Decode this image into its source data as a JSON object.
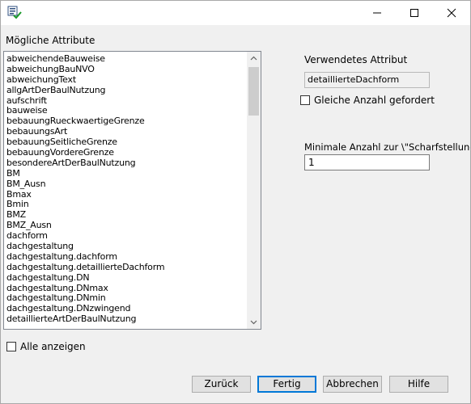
{
  "window": {
    "minimize_glyph": "—",
    "maximize_glyph": "☐",
    "close_glyph": "✕"
  },
  "available": {
    "label": "Mögliche Attribute",
    "items": [
      "abweichendeBauweise",
      "abweichungBauNVO",
      "abweichungText",
      "allgArtDerBaulNutzung",
      "aufschrift",
      "bauweise",
      "bebauungRueckwaertigeGrenze",
      "bebauungsArt",
      "bebauungSeitlicheGrenze",
      "bebauungVordereGrenze",
      "besondereArtDerBaulNutzung",
      "BM",
      "BM_Ausn",
      "Bmax",
      "Bmin",
      "BMZ",
      "BMZ_Ausn",
      "dachform",
      "dachgestaltung",
      "dachgestaltung.dachform",
      "dachgestaltung.detaillierteDachform",
      "dachgestaltung.DN",
      "dachgestaltung.DNmax",
      "dachgestaltung.DNmin",
      "dachgestaltung.DNzwingend",
      "detaillierteArtDerBaulNutzung"
    ]
  },
  "show_all": {
    "label": "Alle anzeigen",
    "checked": false
  },
  "used": {
    "label": "Verwendetes Attribut",
    "value": "detaillierteDachform"
  },
  "same_count": {
    "label": "Gleiche Anzahl gefordert",
    "checked": false
  },
  "min_count": {
    "label": "Minimale Anzahl zur \\\"Scharfstellung\\\"",
    "value": "1"
  },
  "buttons": {
    "back": "Zurück",
    "finish": "Fertig",
    "cancel": "Abbrechen",
    "help": "Hilfe"
  }
}
